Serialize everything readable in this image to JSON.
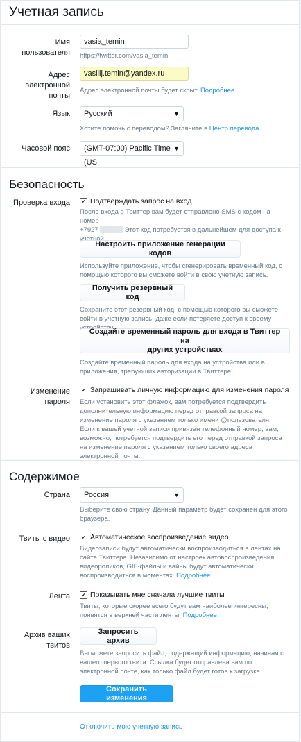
{
  "header": {
    "title": "Учетная запись"
  },
  "account": {
    "username_label": "Имя пользователя",
    "username_value": "vasia_temin",
    "username_url": "https://twitter.com/vasia_temin",
    "email_label_1": "Адрес электронной",
    "email_label_2": "почты",
    "email_value": "vasilij.temin@yandex.ru",
    "email_help": "Адрес электронной почты будет скрыт.",
    "email_help_link": "Подробнее.",
    "language_label": "Язык",
    "language_value": "Русский",
    "language_help": "Хотите помочь с переводом? Загляните в",
    "language_help_link": "Центр перевода.",
    "timezone_label": "Часовой пояс",
    "timezone_value": "(GMT-07:00) Pacific Time (US"
  },
  "security": {
    "title": "Безопасность",
    "login_check_label": "Проверка входа",
    "login_check_checkbox": "Подтверждать запрос на вход",
    "login_check_help_1": "После входа в Твиттер вам будет отправлено SMS с кодом на номер",
    "login_check_help_phone": "+7927",
    "login_check_help_2": "Этот код потребуется в дальнейшем для доступа к учетной",
    "login_check_help_3": "записи.",
    "setup_app_button": "Настроить приложение генерации кодов",
    "setup_app_help": "Используйте приложение, чтобы сгенерировать временный код, с помощью которого вы сможете войти в свою учетную запись.",
    "backup_code_button": "Получить резервный код",
    "backup_code_help": "Сохраните этот резервный код, с помощью которого вы сможете войти в учетную запись, даже если потеряете доступ к своему устройству.",
    "temp_password_button_1": "Создайте временный пароль для входа в Твиттер на",
    "temp_password_button_2": "других устройствах",
    "temp_password_help": "Создайте временный пароль для входа на устройства или в приложения, требующих авторизации в Твиттере.",
    "password_change_label": "Изменение пароля",
    "password_change_checkbox": "Запрашивать личную информацию для изменения пароля",
    "password_change_help": "Если установить этот флажок, вам потребуется подтвердить дополнительную информацию перед отправкой запроса на изменение пароля с указанием только имени @пользователя. Если к вашей учетной записи привязан телефонный номер, вам, возможно, потребуется подтвердить его перед отправкой запроса на изменение пароля с указанием только своего адреса электронной почты."
  },
  "content": {
    "title": "Содержимое",
    "country_label": "Страна",
    "country_value": "Россия",
    "country_help": "Выберите свою страну. Данный параметр будет сохранен для этого браузера.",
    "video_label": "Твиты с видео",
    "video_checkbox": "Автоматическое воспроизведение видео",
    "video_help": "Видеозаписи будут автоматически воспроизводиться в лентах на сайте Твиттера. Независимо от настроек автовоспроизведения видеороликов, GIF-файлы и вайны будут автоматически воспроизводиться в моментах.",
    "video_help_link": "Подробнее.",
    "feed_label": "Лента",
    "feed_checkbox": "Показывать мне сначала лучшие твиты",
    "feed_help": "Твиты, которые скорее всего будут вам наиболее интересны, появятся в верхней части ленты.",
    "feed_help_link": "Подробнее.",
    "archive_label_1": "Архив ваших",
    "archive_label_2": "твитов",
    "archive_button": "Запросить архив",
    "archive_help": "Вы можете запросить файл, содержащий информацию, начиная с вашего первого твита. Ссылка будет отправлена вам по электронной почте, как только файл будет готов к загрузке."
  },
  "footer": {
    "save_button": "Сохранить изменения",
    "deactivate_link": "Отключить мою учетную запись"
  }
}
